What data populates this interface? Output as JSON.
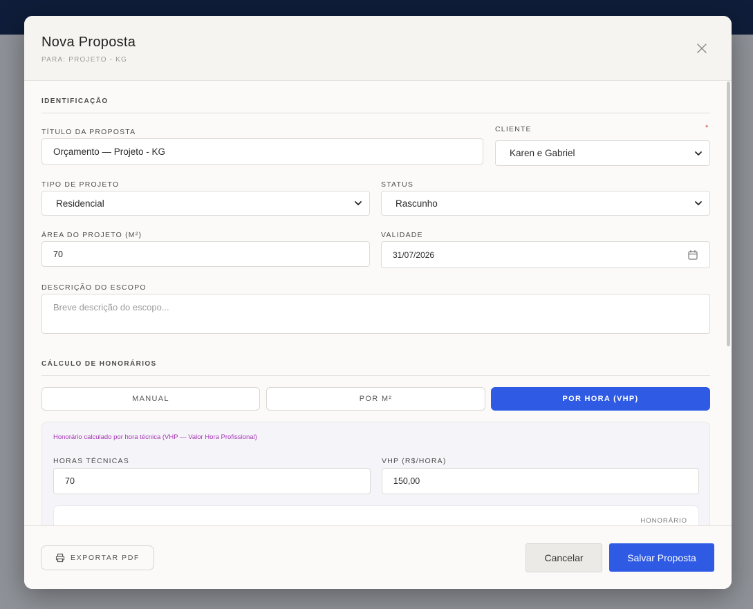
{
  "modal": {
    "title": "Nova Proposta",
    "subtitle": "PARA: PROJETO - KG"
  },
  "identificacao": {
    "section_title": "IDENTIFICAÇÃO",
    "titulo_label": "TÍTULO DA PROPOSTA",
    "titulo_value": "Orçamento — Projeto - KG",
    "cliente_label": "CLIENTE",
    "cliente_required_mark": "*",
    "cliente_value": "Karen e Gabriel",
    "tipo_label": "TIPO DE PROJETO",
    "tipo_value": "Residencial",
    "status_label": "STATUS",
    "status_value": "Rascunho",
    "area_label": "ÁREA DO PROJETO (M²)",
    "area_value": "70",
    "validade_label": "VALIDADE",
    "validade_value": "31/07/2026",
    "descricao_label": "DESCRIÇÃO DO ESCOPO",
    "descricao_placeholder": "Breve descrição do escopo..."
  },
  "honorarios": {
    "section_title": "CÁLCULO DE HONORÁRIOS",
    "modes": [
      {
        "label": "MANUAL",
        "active": false
      },
      {
        "label": "POR M²",
        "active": false
      },
      {
        "label": "POR HORA (VHP)",
        "active": true
      }
    ],
    "note": "Honorário calculado por hora técnica (VHP — Valor Hora Profissional)",
    "horas_label": "HORAS TÉCNICAS",
    "horas_value": "70",
    "vhp_label": "VHP (R$/HORA)",
    "vhp_value": "150,00",
    "honorario_label": "HONORÁRIO"
  },
  "footer": {
    "export_label": "EXPORTAR PDF",
    "cancel_label": "Cancelar",
    "save_label": "Salvar Proposta"
  },
  "colors": {
    "primary": "#2e5ae4",
    "accent_note": "#a535b5",
    "required": "#d23b3b"
  },
  "icons": {
    "close": "close-icon",
    "chevron": "chevron-down-icon",
    "calendar": "calendar-icon",
    "printer": "printer-icon"
  }
}
